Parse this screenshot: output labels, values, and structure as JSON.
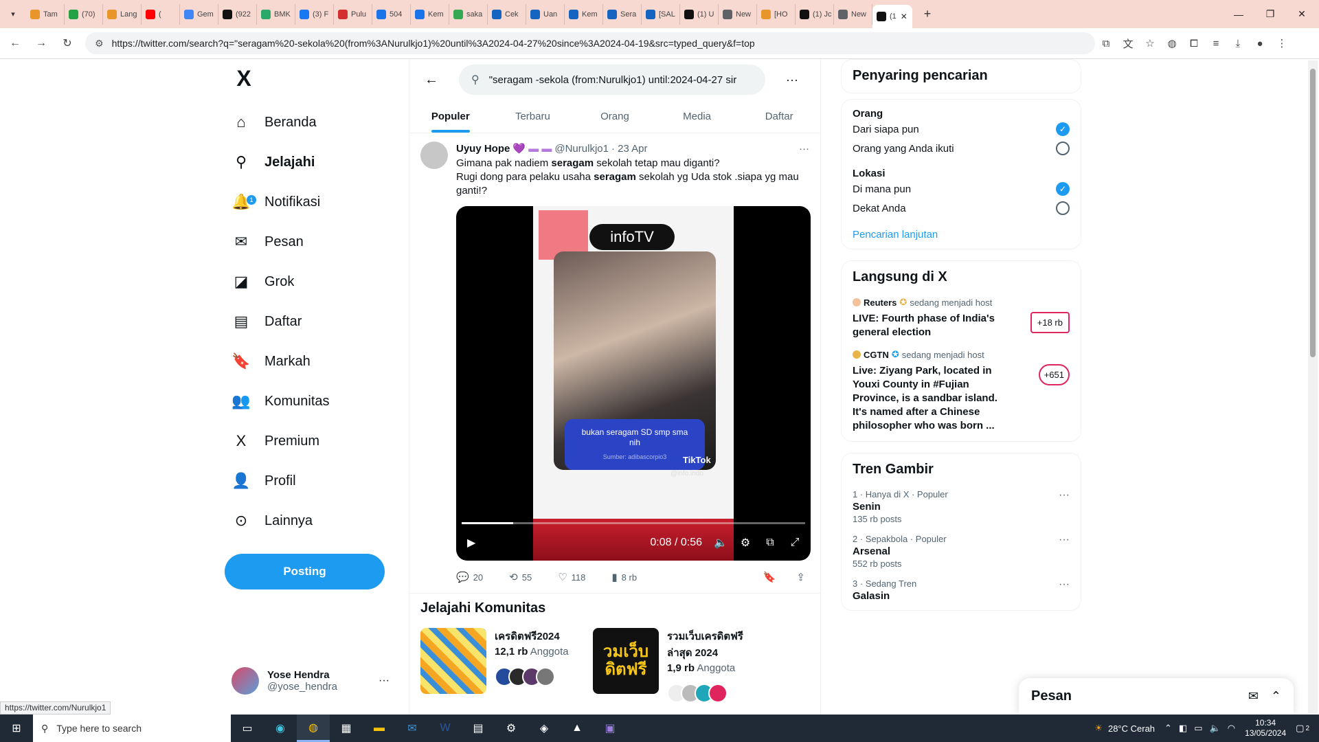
{
  "browser": {
    "tabs": [
      "Tam",
      "(70)",
      "Lang",
      "(",
      "Gem",
      "(922",
      "BMK",
      "(3) F",
      "Pulu",
      "504",
      "Kem",
      "saka",
      "Cek",
      "Uan",
      "Kem",
      "Sera",
      "[SAL",
      "(1) U",
      "New",
      "[HO",
      "(1) Jc",
      "New",
      "(1"
    ],
    "tab_colors": [
      "#e8962a",
      "#25a244",
      "#e8962a",
      "#ff0000",
      "#4285f4",
      "#111111",
      "#2aa96a",
      "#1877f2",
      "#d32f2f",
      "#1a73e8",
      "#1a73e8",
      "#34a853",
      "#1565c0",
      "#1565c0",
      "#1565c0",
      "#1565c0",
      "#1565c0",
      "#111111",
      "#5f6368",
      "#e8962a",
      "#111111",
      "#5f6368",
      "#111111"
    ],
    "url": "https://twitter.com/search?q=\"seragam%20-sekola%20(from%3ANurulkjo1)%20until%3A2024-04-27%20since%3A2024-04-19&src=typed_query&f=top"
  },
  "sidebar": {
    "logo": "X",
    "items": [
      {
        "label": "Beranda",
        "icon": "home-icon"
      },
      {
        "label": "Jelajahi",
        "icon": "search-icon"
      },
      {
        "label": "Notifikasi",
        "icon": "bell-icon"
      },
      {
        "label": "Pesan",
        "icon": "mail-icon"
      },
      {
        "label": "Grok",
        "icon": "grok-icon"
      },
      {
        "label": "Daftar",
        "icon": "list-icon"
      },
      {
        "label": "Markah",
        "icon": "bookmark-icon"
      },
      {
        "label": "Komunitas",
        "icon": "people-icon"
      },
      {
        "label": "Premium",
        "icon": "x-icon"
      },
      {
        "label": "Profil",
        "icon": "person-icon"
      },
      {
        "label": "Lainnya",
        "icon": "more-circle-icon"
      }
    ],
    "notif_count": "1",
    "post_label": "Posting",
    "account": {
      "name": "Yose Hendra",
      "handle": "@yose_hendra"
    }
  },
  "search": {
    "query": "\"seragam -sekola (from:Nurulkjo1) until:2024-04-27 sir",
    "tabs": [
      "Populer",
      "Terbaru",
      "Orang",
      "Media",
      "Daftar"
    ]
  },
  "tweet": {
    "name": "Uyuy Hope",
    "handle": "@Nurulkjo1",
    "date": "· 23 Apr",
    "line1_pre": "Gimana pak nadiem ",
    "line1_bold": "seragam",
    "line1_post": " sekolah tetap mau diganti?",
    "line2_pre": "Rugi dong para pelaku usaha ",
    "line2_bold": "seragam",
    "line2_post": " sekolah yg Uda stok .siapa yg mau ganti!?",
    "video": {
      "brand": "infoTV",
      "caption": "bukan seragam SD smp sma nih",
      "source": "Sumber: adibascorpio3",
      "tiktok": "TikTok",
      "watermark": "@info.indo",
      "time": "0:08 / 0:56",
      "progress": 0.15
    },
    "replies": "20",
    "reposts": "55",
    "likes": "118",
    "views": "8 rb"
  },
  "communities": {
    "title": "Jelajahi Komunitas",
    "items": [
      {
        "title": "เครดิตฟรี2024",
        "count": "12,1 rb",
        "label": "Anggota"
      },
      {
        "title": "รวมเว็บเครดิตฟรีล่าสุด 2024",
        "count": "1,9 rb",
        "label": "Anggota",
        "image_text": "วมเว็บ ดิตฟรี"
      }
    ]
  },
  "filter": {
    "title": "Penyaring pencarian",
    "people_label": "Orang",
    "people_opts": [
      "Dari siapa pun",
      "Orang yang Anda ikuti"
    ],
    "loc_label": "Lokasi",
    "loc_opts": [
      "Di mana pun",
      "Dekat Anda"
    ],
    "advanced": "Pencarian lanjutan"
  },
  "live": {
    "title": "Langsung di X",
    "items": [
      {
        "host": "Reuters",
        "suffix": "sedang menjadi host",
        "title": "LIVE: Fourth phase of India's general election",
        "badge": "+18 rb"
      },
      {
        "host": "CGTN",
        "suffix": "sedang menjadi host",
        "title": "Live: Ziyang Park, located in Youxi County in #Fujian Province, is a sandbar island. It's named after a Chinese philosopher who was born ...",
        "badge": "+651"
      }
    ]
  },
  "trends": {
    "title": "Tren Gambir",
    "items": [
      {
        "meta": "1 · Hanya di X · Populer",
        "title": "Senin",
        "count": "135 rb posts"
      },
      {
        "meta": "2 · Sepakbola · Populer",
        "title": "Arsenal",
        "count": "552 rb posts"
      },
      {
        "meta": "3 · Sedang Tren",
        "title": "Galasin",
        "count": ""
      }
    ]
  },
  "messages": {
    "title": "Pesan"
  },
  "status_link": "https://twitter.com/Nurulkjo1",
  "taskbar": {
    "search_placeholder": "Type here to search",
    "weather": "28°C  Cerah",
    "time": "10:34",
    "date": "13/05/2024",
    "notif": "2"
  }
}
